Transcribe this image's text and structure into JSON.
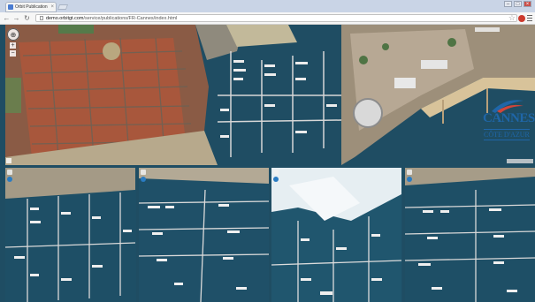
{
  "browser": {
    "tab_title": "Orbit Publication",
    "url_host": "demo.orbitgt.com",
    "url_path": "/service/publications/FR-Cannes/index.html",
    "window_controls": [
      "–",
      "□",
      "×"
    ],
    "nav_icons": [
      "back-icon",
      "forward-icon",
      "reload-icon"
    ]
  },
  "map": {
    "compass_glyph": "⊕",
    "zoom_in": "+",
    "zoom_out": "−",
    "logo": {
      "word": "CANNES",
      "sub": "CÔTE D'AZUR",
      "colors": {
        "blue": "#1f66a8",
        "red": "#d2453a"
      }
    }
  },
  "thumbnails": [
    {
      "name": "oblique-view-1"
    },
    {
      "name": "oblique-view-2"
    },
    {
      "name": "oblique-view-3"
    },
    {
      "name": "oblique-view-4"
    }
  ],
  "colors": {
    "water": "#1f4d63",
    "sand": "#c9b28c",
    "roofs": "#b55a3a",
    "pier": "#d7d7d7"
  }
}
